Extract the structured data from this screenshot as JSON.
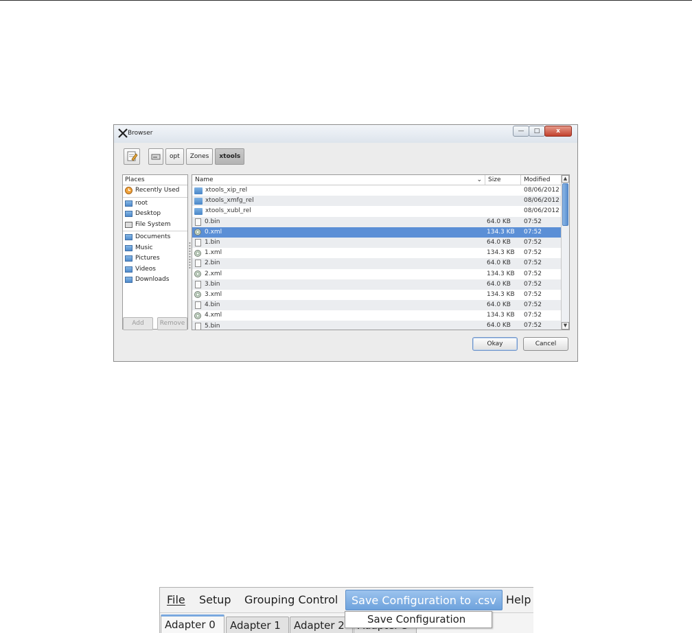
{
  "dialog": {
    "title": "Browser",
    "window_buttons": {
      "minimize": "—",
      "maximize": "□",
      "close": "x"
    },
    "breadcrumbs": [
      "opt",
      "Zones",
      "xtools"
    ],
    "places": {
      "header": "Places",
      "group1": [
        "Recently Used"
      ],
      "group2": [
        "root",
        "Desktop",
        "File System"
      ],
      "group3": [
        "Documents",
        "Music",
        "Pictures",
        "Videos",
        "Downloads"
      ],
      "add_label": "Add",
      "remove_label": "Remove"
    },
    "files": {
      "columns": {
        "name": "Name",
        "size": "Size",
        "modified": "Modified"
      },
      "rows": [
        {
          "icon": "folder-icon",
          "name": "xtools_xip_rel",
          "size": "",
          "modified": "08/06/2012"
        },
        {
          "icon": "folder-icon",
          "name": "xtools_xmfg_rel",
          "size": "",
          "modified": "08/06/2012"
        },
        {
          "icon": "folder-icon",
          "name": "xtools_xubl_rel",
          "size": "",
          "modified": "08/06/2012"
        },
        {
          "icon": "document-icon",
          "name": "0.bin",
          "size": "64.0 KB",
          "modified": "07:52"
        },
        {
          "icon": "xml-file-icon",
          "name": "0.xml",
          "size": "134.3 KB",
          "modified": "07:52",
          "selected": true
        },
        {
          "icon": "document-icon",
          "name": "1.bin",
          "size": "64.0 KB",
          "modified": "07:52"
        },
        {
          "icon": "xml-file-icon",
          "name": "1.xml",
          "size": "134.3 KB",
          "modified": "07:52"
        },
        {
          "icon": "document-icon",
          "name": "2.bin",
          "size": "64.0 KB",
          "modified": "07:52"
        },
        {
          "icon": "xml-file-icon",
          "name": "2.xml",
          "size": "134.3 KB",
          "modified": "07:52"
        },
        {
          "icon": "document-icon",
          "name": "3.bin",
          "size": "64.0 KB",
          "modified": "07:52"
        },
        {
          "icon": "xml-file-icon",
          "name": "3.xml",
          "size": "134.3 KB",
          "modified": "07:52"
        },
        {
          "icon": "document-icon",
          "name": "4.bin",
          "size": "64.0 KB",
          "modified": "07:52"
        },
        {
          "icon": "xml-file-icon",
          "name": "4.xml",
          "size": "134.3 KB",
          "modified": "07:52"
        },
        {
          "icon": "document-icon",
          "name": "5.bin",
          "size": "64.0 KB",
          "modified": "07:52"
        }
      ]
    },
    "buttons": {
      "okay": "Okay",
      "cancel": "Cancel"
    }
  },
  "app": {
    "menu": [
      "File",
      "Setup",
      "Grouping Control",
      "Save Configuration to .csv",
      "Help"
    ],
    "active_menu": "Save Configuration to .csv",
    "dropdown_item": "Save Configuration",
    "tabs": [
      "Adapter 0",
      "Adapter 1",
      "Adapter 2",
      "Adapter 3"
    ]
  },
  "colors": {
    "selection": "#5b8fd6",
    "menu_highlight": "#6ea2dc",
    "tab_accent": "#79a8df"
  }
}
